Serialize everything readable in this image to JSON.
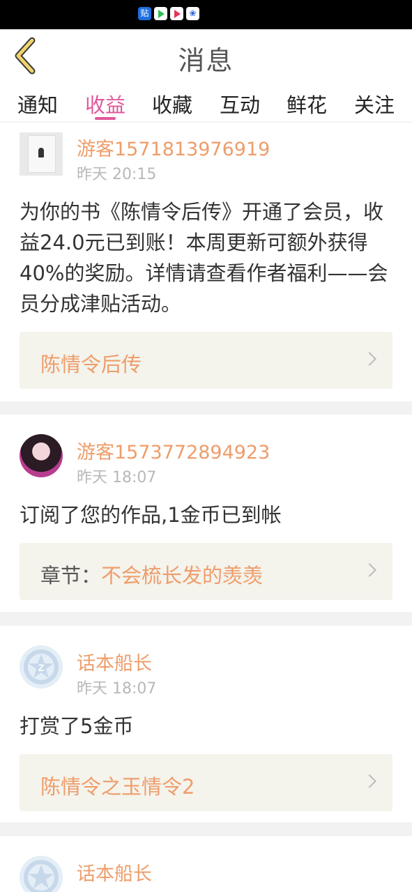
{
  "header": {
    "title": "消息"
  },
  "tabs": [
    {
      "label": "通知"
    },
    {
      "label": "收益"
    },
    {
      "label": "收藏"
    },
    {
      "label": "互动"
    },
    {
      "label": "鲜花"
    },
    {
      "label": "关注"
    }
  ],
  "active_tab": "收益",
  "accent_color": "#e0589a",
  "name_color": "#ee9d6a",
  "messages": [
    {
      "user": "游客1571813976919",
      "time": "昨天 20:15",
      "text": "为你的书《陈情令后传》开通了会员，收益24.0元已到账！本周更新可额外获得40%的奖励。详情请查看作者福利——会员分成津贴活动。",
      "link_prefix": "",
      "link": "陈情令后传"
    },
    {
      "user": "游客1573772894923",
      "time": "昨天 18:07",
      "text": "订阅了您的作品,1金币已到帐",
      "link_prefix": "章节：",
      "link": "不会梳长发的羡羡"
    },
    {
      "user": "话本船长",
      "time": "昨天 18:07",
      "text": "打赏了5金币",
      "link_prefix": "",
      "link": "陈情令之玉情令2"
    },
    {
      "user": "话本船长"
    }
  ]
}
